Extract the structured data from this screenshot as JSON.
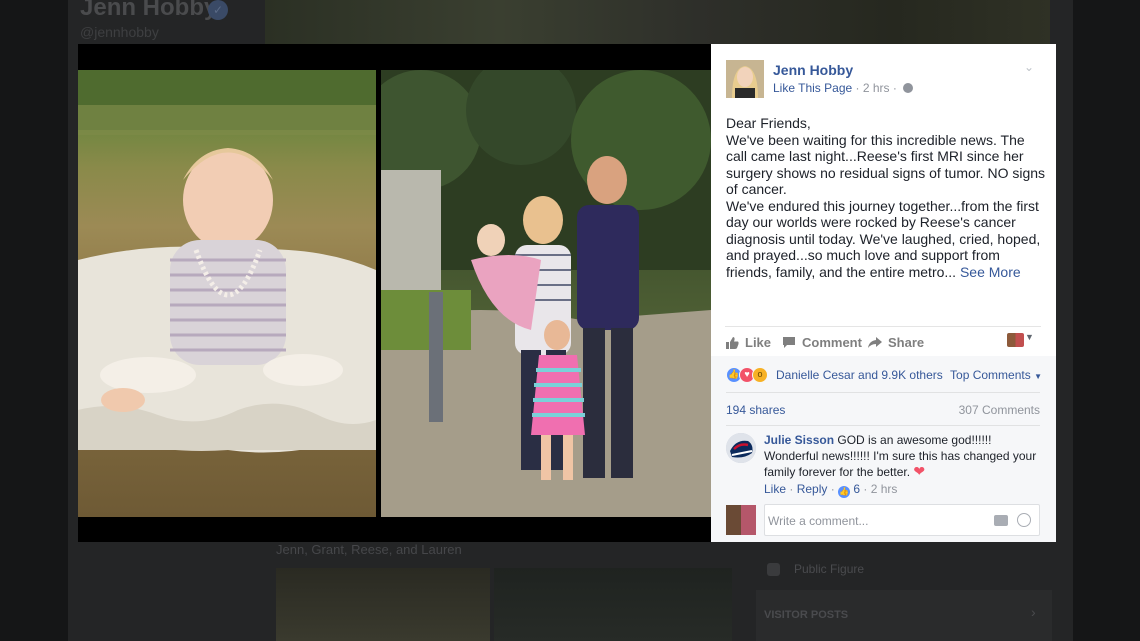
{
  "background_page": {
    "page_name": "Jenn Hobby",
    "handle": "@jennhobby",
    "photo_caption": "Jenn, Grant, Reese, and Lauren",
    "sidebar_items": [
      "Public Figure"
    ],
    "visitor_posts_label": "VISITOR POSTS"
  },
  "post": {
    "author": "Jenn Hobby",
    "like_page_label": "Like This Page",
    "meta_separator": "·",
    "time": "2 hrs",
    "paragraphs": [
      "Dear Friends,",
      "We've been waiting for this incredible news. The call came last night...Reese's first MRI since her surgery shows no residual signs of tumor. NO signs of cancer.",
      "We've endured this journey together...from the first day our worlds were rocked by Reese's cancer diagnosis until today. We've laughed, cried, hoped, and prayed...so much love and support from friends, family, and the entire metro..."
    ],
    "see_more_label": "See More"
  },
  "actions": {
    "like_label": "Like",
    "comment_label": "Comment",
    "share_label": "Share"
  },
  "reactions": {
    "names": "Danielle Cesar and 9.9K others",
    "top_comments_label": "Top Comments",
    "types": [
      "like",
      "love",
      "wow"
    ]
  },
  "stats": {
    "shares": "194 shares",
    "comments": "307 Comments"
  },
  "comment": {
    "author": "Julie Sisson",
    "text": "GOD is an awesome god!!!!!! Wonderful news!!!!!! I'm sure this has changed your family forever for the better.",
    "like_label": "Like",
    "reply_label": "Reply",
    "like_count": "6",
    "time": "2 hrs"
  },
  "composer": {
    "placeholder": "Write a comment..."
  },
  "colors": {
    "link_blue": "#365899",
    "like_blue": "#5890ff",
    "love_red": "#f25268",
    "wow_yellow": "#f7b125"
  },
  "icons": [
    "verified-badge-icon",
    "globe-icon",
    "chevron-down-icon",
    "like-icon",
    "comment-icon",
    "share-icon",
    "camera-icon",
    "smiley-icon",
    "heart-icon"
  ]
}
